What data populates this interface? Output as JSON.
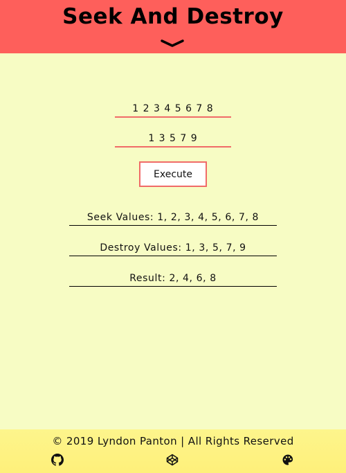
{
  "header": {
    "title": "Seek And Destroy",
    "toggle_icon": "chevron-down-icon"
  },
  "form": {
    "seek_value": "1 2 3 4 5 6 7 8",
    "destroy_value": "1 3 5 7 9",
    "execute_label": "Execute"
  },
  "output": {
    "seek": "Seek Values: 1, 2, 3, 4, 5, 6, 7, 8",
    "destroy": "Destroy Values: 1, 3, 5, 7, 9",
    "result": "Result: 2, 4, 6, 8"
  },
  "footer": {
    "copyright": "© 2019 Lyndon Panton | All Rights Reserved",
    "icons": [
      "github-icon",
      "codepen-icon",
      "palette-icon"
    ]
  },
  "colors": {
    "header": "#fe5f5b",
    "background": "#f7fcc4",
    "footer": "#fdf58c",
    "accent": "#f06a68"
  }
}
